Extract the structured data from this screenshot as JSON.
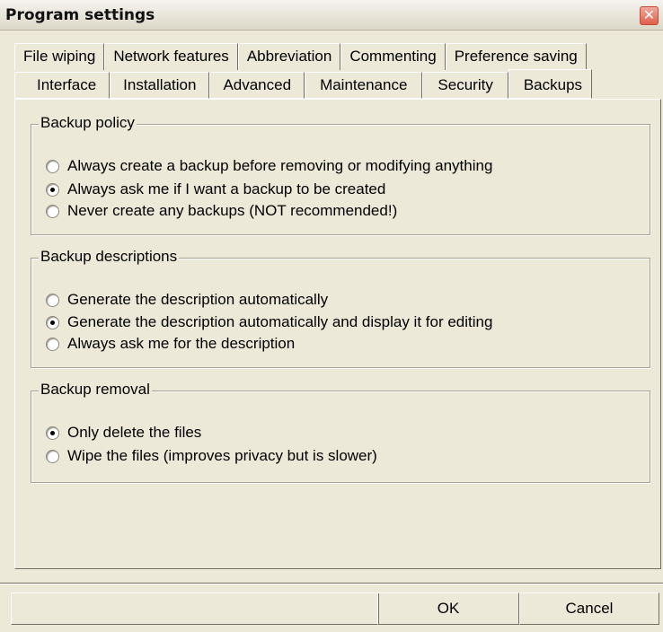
{
  "window": {
    "title": "Program settings",
    "close_glyph": "✕"
  },
  "tabs": {
    "back_row": [
      "File wiping",
      "Network features",
      "Abbreviation",
      "Commenting",
      "Preference saving"
    ],
    "front_row": [
      "Interface",
      "Installation",
      "Advanced",
      "Maintenance",
      "Security",
      "Backups"
    ],
    "active": "Backups"
  },
  "groups": {
    "policy": {
      "title": "Backup policy",
      "options": [
        {
          "label": "Always create a backup before removing or modifying anything",
          "checked": false
        },
        {
          "label": "Always ask me if I want a backup to be created",
          "checked": true
        },
        {
          "label": "Never create any backups (NOT recommended!)",
          "checked": false
        }
      ]
    },
    "descriptions": {
      "title": "Backup descriptions",
      "options": [
        {
          "label": "Generate the description automatically",
          "checked": false
        },
        {
          "label": "Generate the description automatically and display it for editing",
          "checked": true
        },
        {
          "label": "Always ask me for the description",
          "checked": false
        }
      ]
    },
    "removal": {
      "title": "Backup removal",
      "options": [
        {
          "label": "Only delete the files",
          "checked": true
        },
        {
          "label": "Wipe the files (improves privacy but is slower)",
          "checked": false
        }
      ]
    }
  },
  "buttons": {
    "ok": "OK",
    "cancel": "Cancel"
  },
  "colors": {
    "window_bg": "#ece9d8",
    "close_button": "#e0604c"
  }
}
